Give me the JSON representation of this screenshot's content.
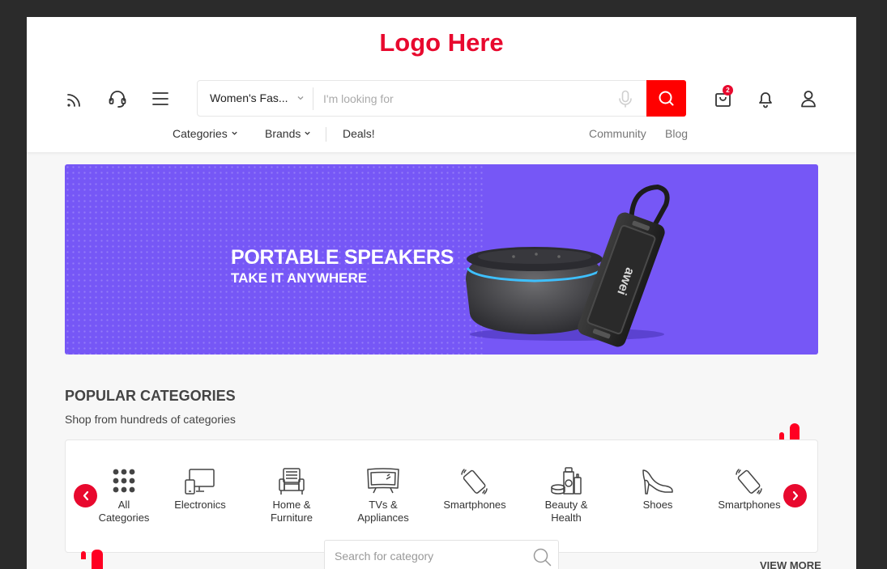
{
  "header": {
    "logo": "Logo Here",
    "icons": [
      "rss-icon",
      "headset-icon",
      "menu-icon"
    ],
    "search": {
      "category": "Women's Fas...",
      "placeholder": "I'm looking for"
    },
    "cart_count": "2"
  },
  "nav": {
    "categories": "Categories",
    "brands": "Brands",
    "deals": "Deals!",
    "community": "Community",
    "blog": "Blog"
  },
  "banner": {
    "headline": "PORTABLE SPEAKERS",
    "subline": "TAKE IT ANYWHERE",
    "speaker_brand": "awei",
    "background_color": "#7657f6"
  },
  "popular": {
    "title": "POPULAR CATEGORIES",
    "subtitle": "Shop from hundreds of categories",
    "items": [
      {
        "label": "All\nCategories",
        "icon": "grid-dots-icon"
      },
      {
        "label": "Electronics",
        "icon": "devices-icon"
      },
      {
        "label": "Home &\nFurniture",
        "icon": "armchair-icon"
      },
      {
        "label": "TVs &\nAppliances",
        "icon": "tv-icon"
      },
      {
        "label": "Smartphones",
        "icon": "smartphone-icon"
      },
      {
        "label": "Beauty &\nHealth",
        "icon": "cosmetics-icon"
      },
      {
        "label": "Shoes",
        "icon": "high-heel-icon"
      },
      {
        "label": "Smartphones",
        "icon": "smartphone-icon"
      }
    ],
    "search_placeholder": "Search for category",
    "view_more": "VIEW MORE"
  },
  "colors": {
    "accent": "#e8092e",
    "search_button": "#ff0000"
  }
}
